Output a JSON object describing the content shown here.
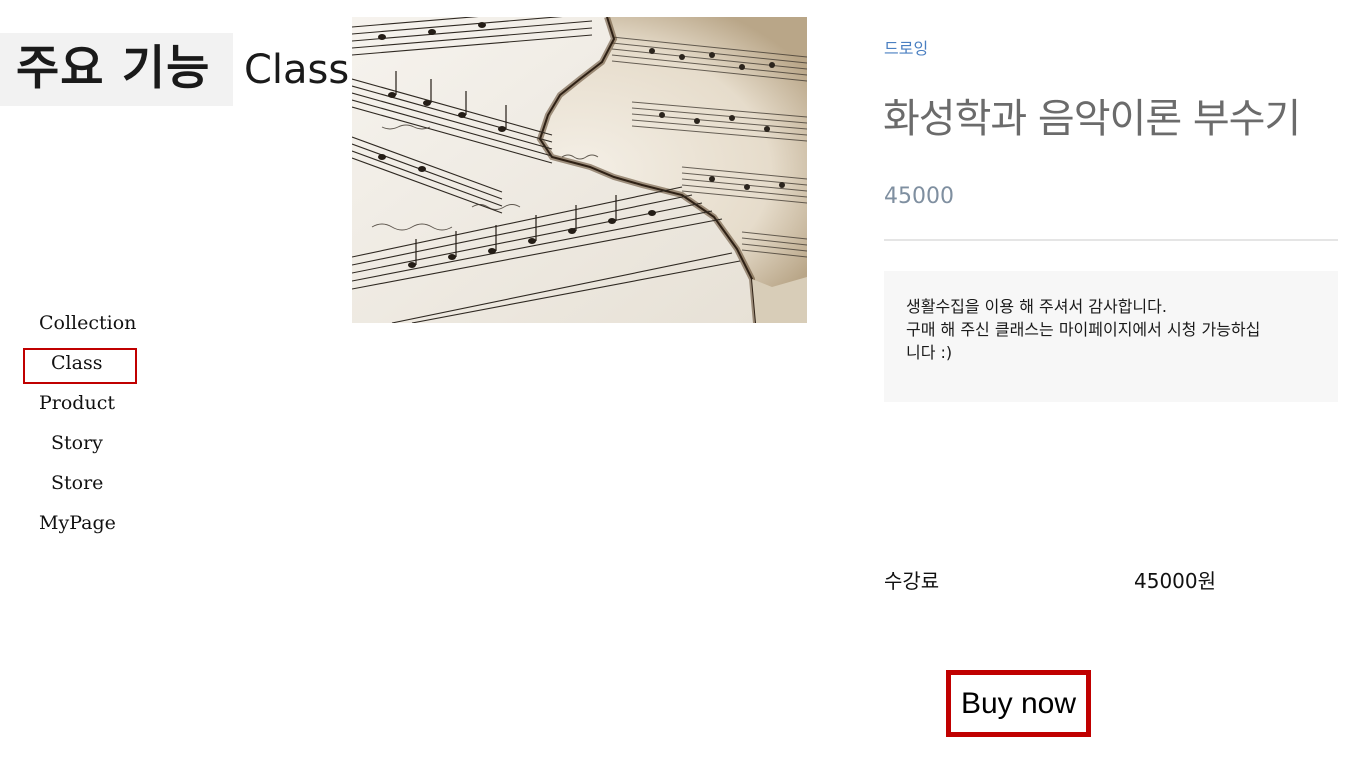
{
  "heading": {
    "main": "주요 기능",
    "sub": "Class"
  },
  "sidebar": {
    "items": [
      {
        "label": "Collection"
      },
      {
        "label": "Class",
        "active": true
      },
      {
        "label": "Product"
      },
      {
        "label": "Story"
      },
      {
        "label": "Store"
      },
      {
        "label": "MyPage"
      }
    ]
  },
  "product": {
    "category": "드로잉",
    "title": "화성학과 음악이론 부수기",
    "price": "45000",
    "notice_lines": [
      "생활수집을 이용 해 주셔서 감사합니다.",
      "구매 해 주신 클래스는 마이페이지에서 시청 가능하십",
      "니다 :)"
    ],
    "fee_label": "수강료",
    "fee_value": "45000원",
    "buy_label": "Buy now"
  },
  "colors": {
    "highlight": "#c00000",
    "category": "#4a7fc1",
    "title": "#6b6b6b",
    "price": "#7f8fa0",
    "notice_bg": "#f7f7f7"
  },
  "image": {
    "subject": "burnt sheet music pages"
  }
}
